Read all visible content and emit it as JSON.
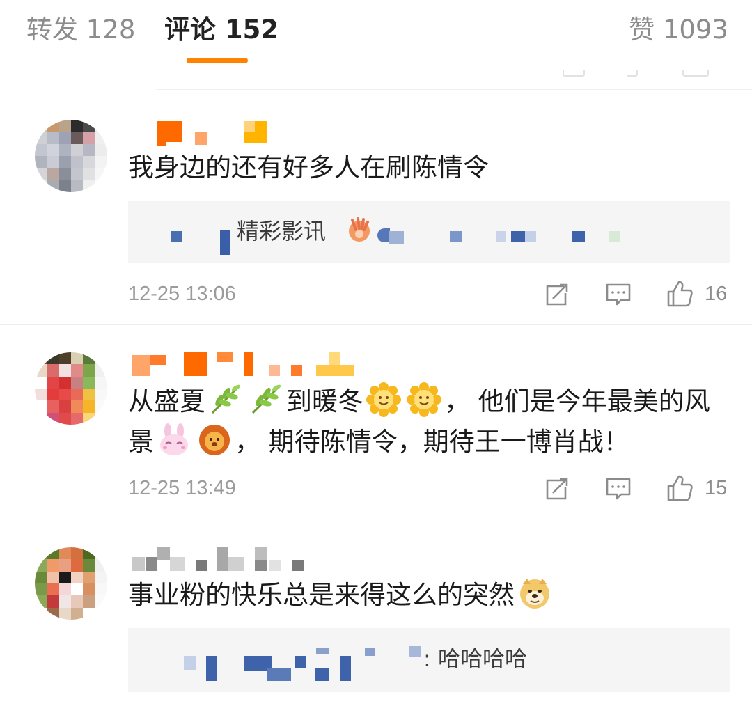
{
  "tabs": {
    "forward": "转发 128",
    "comments": "评论 152",
    "likes": "赞 1093",
    "accent_color": "#ff8200"
  },
  "comments": [
    {
      "text": "我身边的还有好多人在刷陈情令",
      "reply_text": "精彩影讯",
      "reply_emoji": "clapping-hands-icon",
      "time": "12-25 13:06",
      "likes": "16"
    },
    {
      "text_parts": [
        "从盛夏",
        "到暖冬",
        "， 他们是今年最美的风景",
        "， 期待陈情令，期待王一博肖战！"
      ],
      "emojis": [
        "leaf-icon",
        "leaf-icon",
        "sunflower-icon",
        "sunflower-icon",
        "bunny-icon",
        "lion-icon"
      ],
      "time": "12-25 13:49",
      "likes": "15"
    },
    {
      "text": "事业粉的快乐总是来得这么的突然",
      "emoji": "doge-icon",
      "reply_text": ": 哈哈哈哈"
    }
  ],
  "icons": {
    "repost": "repost-icon",
    "comment": "comment-icon",
    "like": "thumbs-up-icon"
  }
}
